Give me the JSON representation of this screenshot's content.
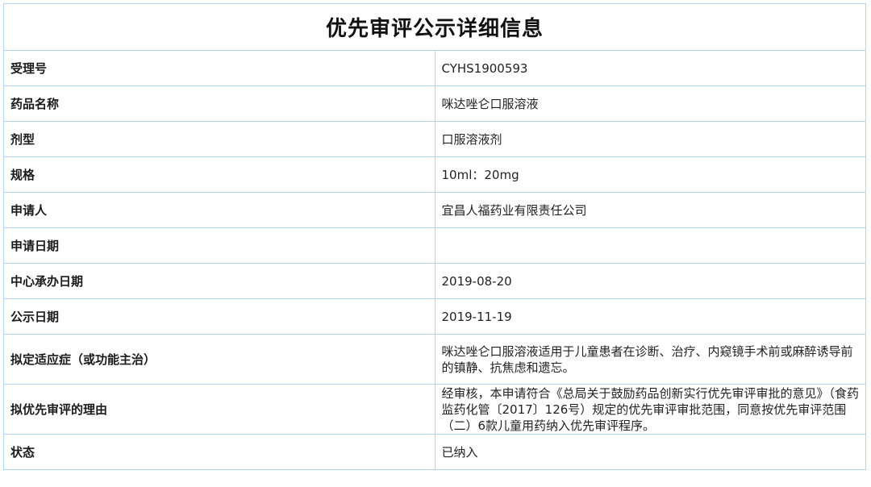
{
  "page": {
    "title": "优先审评公示详细信息"
  },
  "fields": {
    "acceptance_no": {
      "label": "受理号",
      "value": "CYHS1900593"
    },
    "drug_name": {
      "label": "药品名称",
      "value": "咪达唑仑口服溶液"
    },
    "dosage_form": {
      "label": "剂型",
      "value": "口服溶液剂"
    },
    "specification": {
      "label": "规格",
      "value": "10ml：20mg"
    },
    "applicant": {
      "label": "申请人",
      "value": "宜昌人福药业有限责任公司"
    },
    "application_date": {
      "label": "申请日期",
      "value": ""
    },
    "center_undertake_date": {
      "label": "中心承办日期",
      "value": "2019-08-20"
    },
    "publicity_date": {
      "label": "公示日期",
      "value": "2019-11-19"
    },
    "indication": {
      "label": "拟定适应症（或功能主治）",
      "value": "咪达唑仑口服溶液适用于儿童患者在诊断、治疗、内窥镜手术前或麻醉诱导前的镇静、抗焦虑和遗忘。"
    },
    "priority_reason": {
      "label": "拟优先审评的理由",
      "value": "经审核，本申请符合《总局关于鼓励药品创新实行优先审评审批的意见》（食药监药化管〔2017〕126号）规定的优先审评审批范围，同意按优先审评范围（二）6款儿童用药纳入优先审评程序。"
    },
    "status": {
      "label": "状态",
      "value": "已纳入"
    }
  }
}
